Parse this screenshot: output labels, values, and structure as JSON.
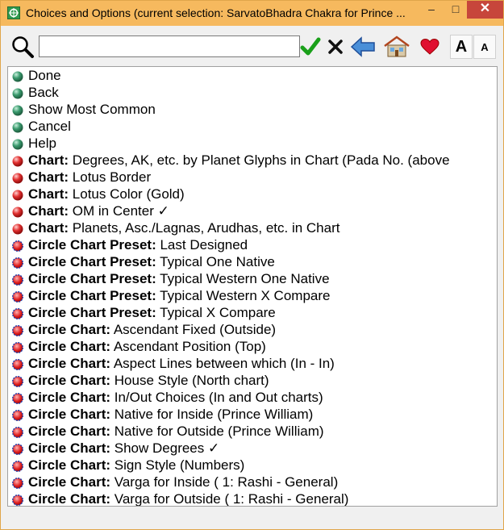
{
  "window": {
    "title": "Choices and Options (current selection: SarvatoBhadra Chakra for Prince ...",
    "min_label": "–",
    "max_label": "□",
    "close_label": "✕"
  },
  "toolbar": {
    "search_value": "",
    "icons": [
      "search-icon",
      "ok-check-icon",
      "clear-x-icon",
      "back-arrow-icon",
      "home-icon",
      "favorite-heart-icon",
      "font-larger-icon",
      "font-smaller-icon"
    ],
    "font_larger_label": "A",
    "font_smaller_label": "A"
  },
  "colors": {
    "titlebar": "#f6b95e",
    "close": "#c7463b",
    "bullet_green": "#3a9a6e",
    "bullet_red": "#e23030",
    "bullet_preset_ring": "#1a3fb0",
    "check_green": "#1aa01a"
  },
  "list": {
    "items": [
      {
        "prefix": "",
        "text": "Done",
        "bullet": "green"
      },
      {
        "prefix": "",
        "text": "Back",
        "bullet": "green"
      },
      {
        "prefix": "",
        "text": "Show Most Common",
        "bullet": "green"
      },
      {
        "prefix": "",
        "text": "Cancel",
        "bullet": "green"
      },
      {
        "prefix": "",
        "text": "Help",
        "bullet": "green"
      },
      {
        "prefix": "Chart:",
        "text": " Degrees, AK, etc. by Planet Glyphs in Chart (Pada No. (above",
        "bullet": "red"
      },
      {
        "prefix": "Chart:",
        "text": " Lotus Border",
        "bullet": "red"
      },
      {
        "prefix": "Chart:",
        "text": " Lotus Color (Gold)",
        "bullet": "red"
      },
      {
        "prefix": "Chart:",
        "text": " OM in Center ✓",
        "bullet": "red"
      },
      {
        "prefix": "Chart:",
        "text": " Planets, Asc./Lagnas, Arudhas, etc. in Chart",
        "bullet": "red"
      },
      {
        "prefix": "Circle Chart Preset:",
        "text": " Last Designed",
        "bullet": "circle"
      },
      {
        "prefix": "Circle Chart Preset:",
        "text": " Typical One Native",
        "bullet": "circle"
      },
      {
        "prefix": "Circle Chart Preset:",
        "text": " Typical Western One Native",
        "bullet": "circle"
      },
      {
        "prefix": "Circle Chart Preset:",
        "text": " Typical Western X Compare",
        "bullet": "circle"
      },
      {
        "prefix": "Circle Chart Preset:",
        "text": " Typical X Compare",
        "bullet": "circle"
      },
      {
        "prefix": "Circle Chart:",
        "text": " Ascendant Fixed (Outside)",
        "bullet": "circle"
      },
      {
        "prefix": "Circle Chart:",
        "text": " Ascendant Position (Top)",
        "bullet": "circle"
      },
      {
        "prefix": "Circle Chart:",
        "text": " Aspect Lines between which (In - In)",
        "bullet": "circle"
      },
      {
        "prefix": "Circle Chart:",
        "text": " House Style (North chart)",
        "bullet": "circle"
      },
      {
        "prefix": "Circle Chart:",
        "text": " In/Out Choices (In and Out charts)",
        "bullet": "circle"
      },
      {
        "prefix": "Circle Chart:",
        "text": " Native for Inside (Prince William)",
        "bullet": "circle"
      },
      {
        "prefix": "Circle Chart:",
        "text": " Native for Outside (Prince William)",
        "bullet": "circle"
      },
      {
        "prefix": "Circle Chart:",
        "text": " Show Degrees ✓",
        "bullet": "circle"
      },
      {
        "prefix": "Circle Chart:",
        "text": " Sign Style (Numbers)",
        "bullet": "circle"
      },
      {
        "prefix": "Circle Chart:",
        "text": " Varga for Inside (  1: Rashi - General)",
        "bullet": "circle"
      },
      {
        "prefix": "Circle Chart:",
        "text": " Varga for Outside (  1: Rashi - General)",
        "bullet": "circle"
      }
    ]
  }
}
